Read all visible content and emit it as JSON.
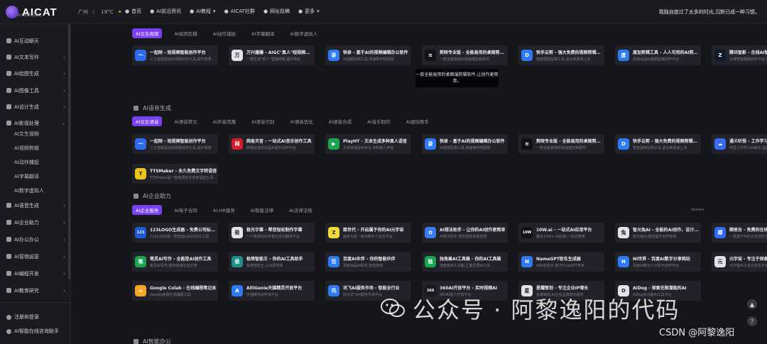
{
  "header": {
    "brand": "AICAT",
    "brand_sub": "AI工具导航网站",
    "city": "广州",
    "temperature": "19°C",
    "nav": [
      {
        "label": "首页",
        "icon": "home-icon"
      },
      {
        "label": "AI前沿资讯",
        "icon": "news-icon"
      },
      {
        "label": "AI教程",
        "icon": "book-icon",
        "dropdown": true
      },
      {
        "label": "AICAT社群",
        "icon": "group-icon"
      },
      {
        "label": "网址投稿",
        "icon": "link-icon"
      },
      {
        "label": "更多",
        "icon": "grid-icon",
        "dropdown": true
      }
    ],
    "slogan": "我独自度过了太多的时光,沉默已成一种习惯。"
  },
  "sidebar": {
    "items": [
      {
        "label": "AI互动聊天",
        "arrow": ""
      },
      {
        "label": "AI文本写作",
        "arrow": "›"
      },
      {
        "label": "AI绘图生成",
        "arrow": "›"
      },
      {
        "label": "AI图像工具",
        "arrow": "›"
      },
      {
        "label": "AI设计生成",
        "arrow": "›"
      },
      {
        "label": "AI影视处理",
        "arrow": "⌄"
      }
    ],
    "sub_items": [
      "AI文生视频",
      "AI视频剪辑",
      "AI动作捕捉",
      "AI字幕翻译",
      "AI数字虚拟人"
    ],
    "items_after": [
      {
        "label": "AI语音生成",
        "arrow": "›"
      },
      {
        "label": "AI企业助力",
        "arrow": "›"
      },
      {
        "label": "AI办公办公",
        "arrow": "›"
      },
      {
        "label": "AI营销运营",
        "arrow": "›"
      },
      {
        "label": "AI编程开发",
        "arrow": "›"
      },
      {
        "label": "AI教育研究",
        "arrow": "›"
      }
    ],
    "bottom": [
      "注册和登录",
      "AI智能在线咨询助手"
    ]
  },
  "video_section": {
    "tabs": [
      "AI文生视频",
      "AI视频剪辑",
      "AI动作捕捉",
      "AI字幕翻译",
      "AI数字虚拟人"
    ],
    "cards": [
      {
        "title": "一起映 - 短视频智能创作平台",
        "desc": "人工智能驱动的视频创作工具,提升效率",
        "icon_bg": "#2d6cf0",
        "icon": "一"
      },
      {
        "title": "万兴播爆 - AIGC\"真人\"短视频营销",
        "desc": "一键生成\"真人\"营销视频,提升转化",
        "icon_bg": "#e3e3ea",
        "icon": "万"
      },
      {
        "title": "快录 - 基于AI的视频编辑办公软件",
        "desc": "AI视频剪辑工具,快速制作短视频",
        "icon_bg": "#2f7bf5",
        "icon": "录"
      },
      {
        "title": "剪映专业版 - 全能易用的桌面剪辑软件",
        "desc": "一款全能易用的桌面端剪辑软件",
        "icon_bg": "#111114",
        "icon": "≋"
      },
      {
        "title": "快手云剪 - 强大免费的视频剪辑工具",
        "desc": "智能视频剪辑工具,强大免费易上手",
        "icon_bg": "#2f7bf5",
        "icon": "D"
      },
      {
        "title": "度加剪辑工具 - 人人可用的AI剪辑工具",
        "desc": "百度出品AI视频剪辑创作平台",
        "icon_bg": "#2f7bf5",
        "icon": "度"
      },
      {
        "title": "腾讯智影 - 在线AI智能视频创作",
        "desc": "云端智能视频创作平台,提升效率",
        "icon_bg": "#101a2a",
        "icon": "Z"
      }
    ],
    "tooltip": "一款全能易用的桌面端剪辑软件,让创作更简单。"
  },
  "voice_section": {
    "title": "AI语音生成",
    "tabs": [
      "AI文生语音",
      "AI语音转文",
      "AI声音克隆",
      "AI语音识别",
      "AI语音优化",
      "AI语音合成",
      "AI音乐制作",
      "AI虚拟歌手"
    ],
    "cards": [
      {
        "title": "一起映 - 短视频智能创作平台",
        "desc": "人工智能驱动的视频创作工具,提升效率",
        "icon_bg": "#2d6cf0",
        "icon": "一"
      },
      {
        "title": "网易天音 - 一站式AI音乐创作工具",
        "desc": "网易云音乐出品AI音乐创作平台",
        "icon_bg": "#d8182b",
        "icon": "网"
      },
      {
        "title": "PlayHT - 文本生成多种真人语音",
        "desc": "文本转语音AI平台,多种真人声音",
        "icon_bg": "#1aa64e",
        "icon": "▶"
      },
      {
        "title": "快录 - 基于AI的视频编辑办公软件",
        "desc": "AI视频剪辑工具,快速制作短视频",
        "icon_bg": "#2f7bf5",
        "icon": "录"
      },
      {
        "title": "剪映专业版 - 全能易用的桌面剪辑软件",
        "desc": "一款全能易用的桌面端剪辑软件",
        "icon_bg": "#111114",
        "icon": "≋"
      },
      {
        "title": "快手云剪 - 强大免费的视频剪辑工具",
        "desc": "智能视频剪辑工具,强大免费易上手",
        "icon_bg": "#2f7bf5",
        "icon": "D"
      },
      {
        "title": "通义听悟 - 工作学习AI助手",
        "desc": "阿里工作学习AI助手,提高效率",
        "icon_bg": "#3b6bf2",
        "icon": "☁"
      },
      {
        "title": "TTSMaker - 永久免费文字转语音",
        "desc": "TTSMaker是一款免费的文本转语音工具",
        "icon_bg": "#f2c318",
        "icon": "T"
      }
    ]
  },
  "enterprise_section": {
    "title": "AI企业助力",
    "tabs": [
      "AI企业服务",
      "AI电子合同",
      "AI-HR服务",
      "AI智能法律",
      "AI法律法规"
    ],
    "more": "more+",
    "cards": [
      {
        "title": "123LOGO生成器 - 免费公司标志设计",
        "desc": "123LOGO是一款智能LOGO设计工具",
        "icon_bg": "#1e5bd8",
        "icon": "123"
      },
      {
        "title": "极光字幕 - 帮您轻松制作字幕",
        "desc": "一个免费的AI字幕生成与翻译平台",
        "icon_bg": "#e3e3ea",
        "icon": "极"
      },
      {
        "title": "面世代 - 开启属于你的AI元宇宙",
        "desc": "面世代是一款AI数字人社交平台",
        "icon_bg": "#f0d93a",
        "icon": "Z"
      },
      {
        "title": "AI想法助手 - 让你的AI创作更简单",
        "desc": "AI想法助手,帮你轻松实现创意",
        "icon_bg": "#3a7bf0",
        "icon": "✿"
      },
      {
        "title": "10W.ai - 一站式AI应用平台",
        "desc": "聚合10W+ AI应用,一站式使用",
        "icon_bg": "#111114",
        "icon": "10W"
      },
      {
        "title": "智元兔AI - 全能的AI创作、设计平台",
        "desc": "智元兔AI,帮您提升创作效率",
        "icon_bg": "#e3e3ea",
        "icon": "兔"
      },
      {
        "title": "顺思台 - 免费的在线文本创作平台",
        "desc": "一款基于AI的文本创作工具",
        "icon_bg": "#2d6cf0",
        "icon": "顺"
      },
      {
        "title": "笔灵AI写作 - 全能型AI创作工具",
        "desc": "笔灵AI写作,帮你快速生成文章",
        "icon_bg": "#1aa64e",
        "icon": "笔"
      },
      {
        "title": "极简智能王 - 你的AI工具助手",
        "desc": "极简智能王,让AI更简单",
        "icon_bg": "#1b8f8a",
        "icon": "极"
      },
      {
        "title": "百度AI伙伴 - 你的智能伙伴",
        "desc": "百度出品AI助手,智能高效",
        "icon_bg": "#2f7bf5",
        "icon": "百"
      },
      {
        "title": "独角兽AI工具箱 - 你的AI工具箱",
        "desc": "独角兽AI工具箱,汇集优质AI工具",
        "icon_bg": "#1aa64e",
        "icon": "独"
      },
      {
        "title": "NameGPT取名生成器",
        "desc": "AI取名助手,基于ChatGPT技术",
        "icon_bg": "#2f7bf5",
        "icon": "N"
      },
      {
        "title": "NI世界 - 百度AI数字分享网站",
        "desc": "百度AI数字人分享与创作平台",
        "icon_bg": "#2f7bf5",
        "icon": "N"
      },
      {
        "title": "元宇宙 - 专注于探索元宇宙与AI",
        "desc": "元宇宙AI工具与资讯平台",
        "icon_bg": "#e3e3ea",
        "icon": "元"
      },
      {
        "title": "Google Colab - 在线编程笔记本",
        "desc": "Google免费在线编程工具",
        "icon_bg": "#f5a623",
        "icon": "∞"
      },
      {
        "title": "AlliGenie天猫精灵开放平台",
        "desc": "天猫精灵AI开放平台",
        "icon_bg": "#2f7bf5",
        "icon": "A"
      },
      {
        "title": "讯飞AI服务市场 - 智能全行业",
        "desc": "科大讯飞AI服务市场平台",
        "icon_bg": "#2f7bf5",
        "icon": "讯"
      },
      {
        "title": "360AI开放平台 - 实时视频AI",
        "desc": "360AI能力开放平台",
        "icon_bg": "#1a1a1e",
        "icon": "360"
      },
      {
        "title": "星耀策划 - 专注企业IP增长",
        "desc": "星耀策划,AI企业品牌增长服务",
        "icon_bg": "#e3e3ea",
        "icon": "星"
      },
      {
        "title": "AiDog - 探索无限潜能的AI",
        "desc": "AiDog多功能AI工具平台",
        "icon_bg": "#e3e3ea",
        "icon": "D"
      }
    ]
  },
  "bottom_section_title": "AI智能办公",
  "watermark": {
    "text": "公众号 · 阿黎逸阳的代码",
    "csdn": "CSDN @阿黎逸阳"
  },
  "float_buttons": [
    "▲",
    "?"
  ]
}
